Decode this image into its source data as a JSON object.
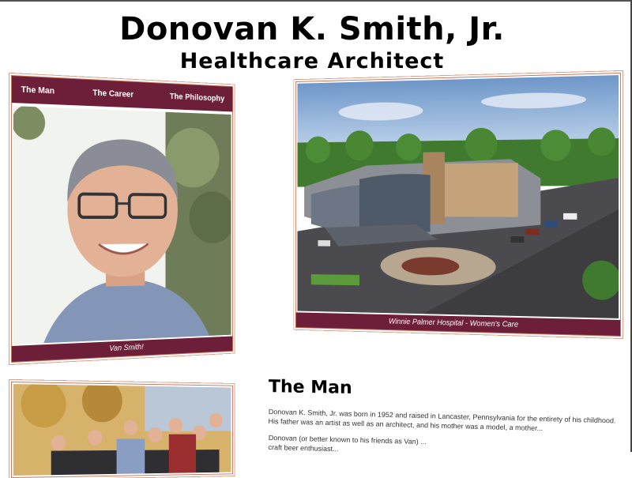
{
  "header": {
    "name": "Donovan K. Smith, Jr.",
    "subtitle": "Healthcare Architect"
  },
  "nav": {
    "items": [
      "The Man",
      "The Career",
      "The Philosophy"
    ]
  },
  "portrait": {
    "caption": "Van Smith!"
  },
  "project": {
    "caption": "Winnie Palmer Hospital - Women's Care"
  },
  "man_section": {
    "heading": "The Man",
    "paragraph1_line1": "Donovan K. Smith, Jr. was born in 1952 and raised in Lancaster, Pennsylvania for the entirety of his childhood.",
    "paragraph1_line2": "His father was an artist as well as an architect, and his mother was a model, a mother...",
    "paragraph2_line1": "Donovan (or better known to his friends as Van) ...",
    "paragraph2_line2": "craft beer enthusiast..."
  },
  "colors": {
    "accent": "#6d1f3a",
    "border": "#c8745a"
  }
}
